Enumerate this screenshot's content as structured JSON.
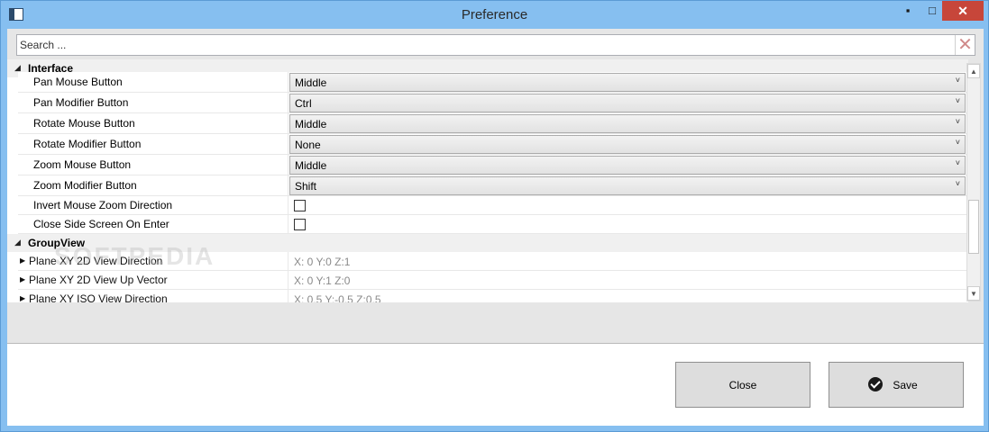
{
  "window": {
    "title": "Preference",
    "minimize": "▪",
    "maximize": "□",
    "close": "✕"
  },
  "search": {
    "placeholder": "Search ..."
  },
  "categories": {
    "interface": {
      "label": "Interface",
      "expanded": true
    },
    "groupview": {
      "label": "GroupView",
      "expanded": true
    }
  },
  "interface_rows": [
    {
      "label": "Pan Mouse Button",
      "value": "Middle",
      "type": "dropdown"
    },
    {
      "label": "Pan Modifier Button",
      "value": "Ctrl",
      "type": "dropdown"
    },
    {
      "label": "Rotate Mouse Button",
      "value": "Middle",
      "type": "dropdown"
    },
    {
      "label": "Rotate Modifier Button",
      "value": "None",
      "type": "dropdown"
    },
    {
      "label": "Zoom Mouse Button",
      "value": "Middle",
      "type": "dropdown"
    },
    {
      "label": "Zoom Modifier Button",
      "value": "Shift",
      "type": "dropdown"
    },
    {
      "label": "Invert Mouse Zoom Direction",
      "value": false,
      "type": "checkbox"
    },
    {
      "label": "Close Side Screen On Enter",
      "value": false,
      "type": "checkbox"
    }
  ],
  "groupview_rows": [
    {
      "label": "Plane XY 2D View Direction",
      "value": "X: 0 Y:0 Z:1"
    },
    {
      "label": "Plane XY 2D View Up Vector",
      "value": "X: 0 Y:1 Z:0"
    },
    {
      "label": "Plane XY ISO View Direction",
      "value": "X: 0.5 Y:-0.5 Z:0.5"
    }
  ],
  "buttons": {
    "close": "Close",
    "save": "Save"
  },
  "watermark": "SOFTPEDIA",
  "colors": {
    "titlebar": "#86bff0",
    "close_button": "#c7463a",
    "panel": "#e6e6e6"
  }
}
